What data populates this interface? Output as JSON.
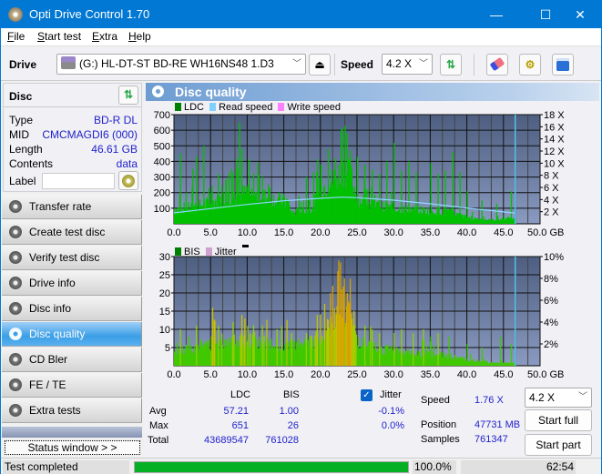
{
  "window": {
    "title": "Opti Drive Control 1.70",
    "controls": {
      "minimize": "—",
      "maximize": "☐",
      "close": "✕"
    }
  },
  "menu": {
    "items": [
      {
        "label": "File",
        "accel": "F",
        "rest": "ile"
      },
      {
        "label": "Start test",
        "accel": "S",
        "rest": "tart test"
      },
      {
        "label": "Extra",
        "accel": "E",
        "rest": "xtra"
      },
      {
        "label": "Help",
        "accel": "H",
        "rest": "elp"
      }
    ]
  },
  "toolbar": {
    "drive_label": "Drive",
    "drive_value": "(G:)  HL-DT-ST BD-RE  WH16NS48 1.D3",
    "speed_label": "Speed",
    "speed_value": "4.2 X",
    "icons": [
      "drive-icon",
      "eject-icon",
      "refresh-icon",
      "erase-icon",
      "settings-icon",
      "save-icon"
    ]
  },
  "disc": {
    "header": "Disc",
    "type_label": "Type",
    "type_value": "BD-R DL",
    "mid_label": "MID",
    "mid_value": "CMCMAGDI6 (000)",
    "length_label": "Length",
    "length_value": "46.61 GB",
    "contents_label": "Contents",
    "contents_value": "data",
    "label_label": "Label",
    "label_value": ""
  },
  "nav": {
    "items": [
      {
        "label": "Transfer rate",
        "active": false
      },
      {
        "label": "Create test disc",
        "active": false
      },
      {
        "label": "Verify test disc",
        "active": false
      },
      {
        "label": "Drive info",
        "active": false
      },
      {
        "label": "Disc info",
        "active": false
      },
      {
        "label": "Disc quality",
        "active": true
      },
      {
        "label": "CD Bler",
        "active": false
      },
      {
        "label": "FE / TE",
        "active": false
      },
      {
        "label": "Extra tests",
        "active": false
      }
    ],
    "status_window": "Status window > >"
  },
  "panel": {
    "title": "Disc quality"
  },
  "chart_data": [
    {
      "type": "bar",
      "title": "LDC",
      "legend": [
        "LDC",
        "Read speed",
        "Write speed"
      ],
      "legend_colors": [
        "#008000",
        "#7fd0ff",
        "#ff80ff"
      ],
      "legend_placement": "top-left",
      "x_ticks": [
        "0.0",
        "5.0",
        "10.0",
        "15.0",
        "20.0",
        "25.0",
        "30.0",
        "35.0",
        "40.0",
        "45.0",
        "50.0 GB"
      ],
      "xlim": [
        0,
        50
      ],
      "y_ticks": [
        "100",
        "200",
        "300",
        "400",
        "500",
        "600",
        "700"
      ],
      "ylim": [
        0,
        700
      ],
      "y2_ticks": [
        "2 X",
        "4 X",
        "6 X",
        "8 X",
        "10 X",
        "12 X",
        "14 X",
        "16 X",
        "18 X"
      ],
      "y2lim": [
        0,
        18
      ],
      "grid": true,
      "end_marker_gb": 46.61,
      "ldc_profile": [
        [
          0,
          120
        ],
        [
          2,
          130
        ],
        [
          4,
          150
        ],
        [
          6,
          190
        ],
        [
          8,
          215
        ],
        [
          9,
          235
        ],
        [
          10,
          235
        ],
        [
          12,
          215
        ],
        [
          14,
          190
        ],
        [
          15.5,
          170
        ],
        [
          16,
          90
        ],
        [
          19,
          110
        ],
        [
          19.5,
          260
        ],
        [
          21,
          310
        ],
        [
          22,
          360
        ],
        [
          23,
          420
        ],
        [
          24,
          380
        ],
        [
          25,
          200
        ],
        [
          27,
          150
        ],
        [
          30,
          120
        ],
        [
          33,
          110
        ],
        [
          35,
          100
        ],
        [
          37,
          100
        ],
        [
          40,
          50
        ],
        [
          43,
          30
        ],
        [
          46.6,
          40
        ]
      ],
      "ldc_spikes": [
        [
          0.8,
          450
        ],
        [
          1.6,
          200
        ],
        [
          2.5,
          350
        ],
        [
          3,
          430
        ],
        [
          4,
          500
        ],
        [
          5,
          200
        ],
        [
          6,
          320
        ],
        [
          7,
          280
        ],
        [
          8,
          330
        ],
        [
          8.5,
          420
        ],
        [
          8.9,
          650
        ],
        [
          9.2,
          480
        ],
        [
          10,
          250
        ],
        [
          11.5,
          240
        ],
        [
          12,
          300
        ],
        [
          13,
          230
        ],
        [
          15,
          180
        ],
        [
          17,
          180
        ],
        [
          18,
          300
        ],
        [
          19,
          330
        ],
        [
          20,
          380
        ],
        [
          21,
          480
        ],
        [
          22,
          420
        ],
        [
          22.8,
          610
        ],
        [
          23.3,
          630
        ],
        [
          23.6,
          580
        ],
        [
          24,
          470
        ],
        [
          25,
          430
        ],
        [
          26,
          380
        ],
        [
          27,
          350
        ],
        [
          28,
          320
        ],
        [
          29,
          400
        ],
        [
          30,
          520
        ],
        [
          31,
          340
        ],
        [
          32,
          400
        ],
        [
          33,
          330
        ],
        [
          35,
          390
        ],
        [
          36,
          320
        ],
        [
          37,
          340
        ],
        [
          38,
          460
        ],
        [
          39,
          330
        ],
        [
          40,
          210
        ],
        [
          42,
          150
        ],
        [
          44,
          130
        ],
        [
          46,
          210
        ]
      ],
      "read_speed_x": [
        [
          0,
          1.8
        ],
        [
          5,
          2.5
        ],
        [
          10,
          3.2
        ],
        [
          15,
          3.8
        ],
        [
          20,
          4.2
        ],
        [
          23,
          4.4
        ],
        [
          25,
          4.3
        ],
        [
          30,
          3.9
        ],
        [
          35,
          3.3
        ],
        [
          40,
          2.6
        ],
        [
          46.6,
          1.76
        ]
      ]
    },
    {
      "type": "bar",
      "title": "BIS",
      "legend": [
        "BIS",
        "Jitter"
      ],
      "legend_colors": [
        "#008000",
        "#d0a0d0"
      ],
      "legend_placement": "top-left",
      "x_ticks": [
        "0.0",
        "5.0",
        "10.0",
        "15.0",
        "20.0",
        "25.0",
        "30.0",
        "35.0",
        "40.0",
        "45.0",
        "50.0 GB"
      ],
      "xlim": [
        0,
        50
      ],
      "y_ticks": [
        "5",
        "10",
        "15",
        "20",
        "25",
        "30"
      ],
      "ylim": [
        0,
        30
      ],
      "y2_ticks": [
        "2%",
        "4%",
        "6%",
        "8%",
        "10%"
      ],
      "y2lim": [
        0,
        10
      ],
      "grid": true,
      "end_marker_gb": 46.61,
      "bis_profile": [
        [
          0,
          4
        ],
        [
          2,
          6
        ],
        [
          4,
          7
        ],
        [
          6,
          8
        ],
        [
          8,
          9
        ],
        [
          10,
          9
        ],
        [
          12,
          8
        ],
        [
          14,
          7
        ],
        [
          16,
          7
        ],
        [
          18,
          7
        ],
        [
          19,
          8
        ],
        [
          20,
          10
        ],
        [
          21,
          13
        ],
        [
          22,
          18
        ],
        [
          23,
          20
        ],
        [
          24,
          16
        ],
        [
          25,
          8
        ],
        [
          27,
          6
        ],
        [
          30,
          5
        ],
        [
          33,
          4
        ],
        [
          35,
          4
        ],
        [
          38,
          3
        ],
        [
          40,
          2
        ],
        [
          43,
          1
        ],
        [
          46.6,
          1
        ]
      ],
      "bis_spikes": [
        [
          0.8,
          10
        ],
        [
          2,
          8
        ],
        [
          3,
          11
        ],
        [
          5.2,
          16
        ],
        [
          6,
          11
        ],
        [
          8,
          12
        ],
        [
          9.2,
          14
        ],
        [
          9.6,
          13
        ],
        [
          10,
          11
        ],
        [
          12,
          11
        ],
        [
          14,
          10
        ],
        [
          16,
          9
        ],
        [
          18,
          9
        ],
        [
          19.5,
          14
        ],
        [
          20.5,
          17
        ],
        [
          21.3,
          20
        ],
        [
          21.6,
          22
        ],
        [
          22.3,
          26
        ],
        [
          22.8,
          21
        ],
        [
          23.2,
          24
        ],
        [
          23.6,
          20
        ],
        [
          24,
          18
        ],
        [
          24.5,
          15
        ],
        [
          26,
          11
        ],
        [
          27,
          10
        ],
        [
          28,
          9
        ],
        [
          30,
          9
        ],
        [
          31,
          10
        ],
        [
          32.6,
          9
        ],
        [
          34,
          10
        ],
        [
          35,
          8
        ],
        [
          36,
          9
        ],
        [
          37.5,
          8
        ],
        [
          40,
          6
        ],
        [
          42,
          5
        ],
        [
          44.5,
          8
        ],
        [
          46,
          6
        ]
      ]
    }
  ],
  "stats": {
    "col_ldc": "LDC",
    "col_bis": "BIS",
    "jitter_checked": true,
    "jitter_label": "Jitter",
    "rows": [
      {
        "label": "Avg",
        "ldc": "57.21",
        "bis": "1.00",
        "jitter": "-0.1%"
      },
      {
        "label": "Max",
        "ldc": "651",
        "bis": "26",
        "jitter": "0.0%"
      },
      {
        "label": "Total",
        "ldc": "43689547",
        "bis": "761028",
        "jitter": ""
      }
    ],
    "speed_label": "Speed",
    "speed_value": "1.76 X",
    "position_label": "Position",
    "position_value": "47731 MB",
    "samples_label": "Samples",
    "samples_value": "761347",
    "speed_select": "4.2 X",
    "start_full": "Start full",
    "start_part": "Start part"
  },
  "statusbar": {
    "status_text": "Test completed",
    "progress_percent": 100.0,
    "progress_text": "100.0%",
    "elapsed": "62:54"
  }
}
